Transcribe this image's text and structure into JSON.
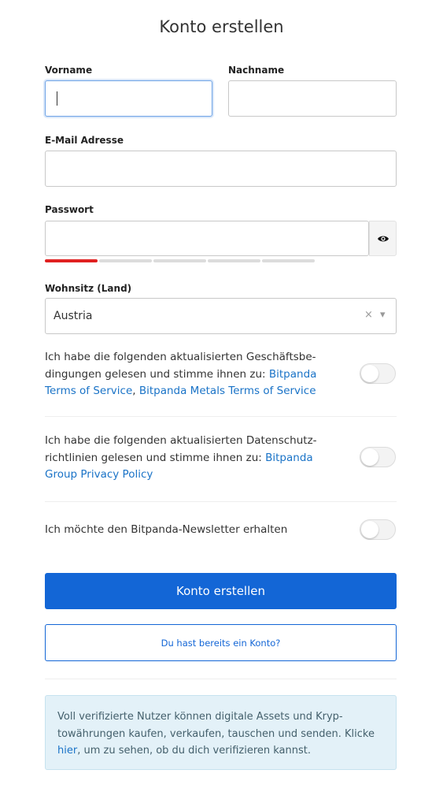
{
  "page": {
    "title": "Konto erstellen"
  },
  "form": {
    "first_name": {
      "label": "Vorname",
      "value": ""
    },
    "last_name": {
      "label": "Nachname",
      "value": ""
    },
    "email": {
      "label": "E-Mail Adresse",
      "value": ""
    },
    "password": {
      "label": "Passwort",
      "value": "",
      "strength_segments": 5,
      "strength_level": 1
    },
    "residence": {
      "label": "Wohnsitz (Land)",
      "value": "Austria",
      "clear_icon": "×",
      "dropdown_icon": "▾"
    }
  },
  "consents": {
    "terms": {
      "text": "Ich habe die folgenden aktualisierten Geschäftsbe-dingungen gelesen und stimme ihnen zu: ",
      "link1": "Bitpanda Terms of Service",
      "sep": ", ",
      "link2": "Bitpanda Metals Terms of Service",
      "checked": false
    },
    "privacy": {
      "text": "Ich habe die folgenden aktualisierten Datenschutz-richtlinien gelesen und stimme ihnen zu: ",
      "link1": "Bitpanda Group Privacy Policy",
      "checked": false
    },
    "newsletter": {
      "text": "Ich möchte den Bitpanda-Newsletter erhalten",
      "checked": false
    }
  },
  "actions": {
    "submit_label": "Konto erstellen",
    "login_label": "Du hast bereits ein Konto?"
  },
  "info": {
    "text_before": "Voll verifizierte Nutzer können digitale Assets und Kryp-towährungen kaufen, verkaufen, tauschen und senden. Klicke ",
    "link": "hier",
    "text_after": ", um zu sehen, ob du dich verifizieren kannst."
  },
  "colors": {
    "primary": "#1366d6",
    "link": "#1a73c7",
    "strength_active": "#e02020",
    "info_bg": "#e3f1f8"
  },
  "icons": {
    "password_toggle": "eye-icon",
    "clear": "close-icon",
    "dropdown": "chevron-down-icon"
  }
}
